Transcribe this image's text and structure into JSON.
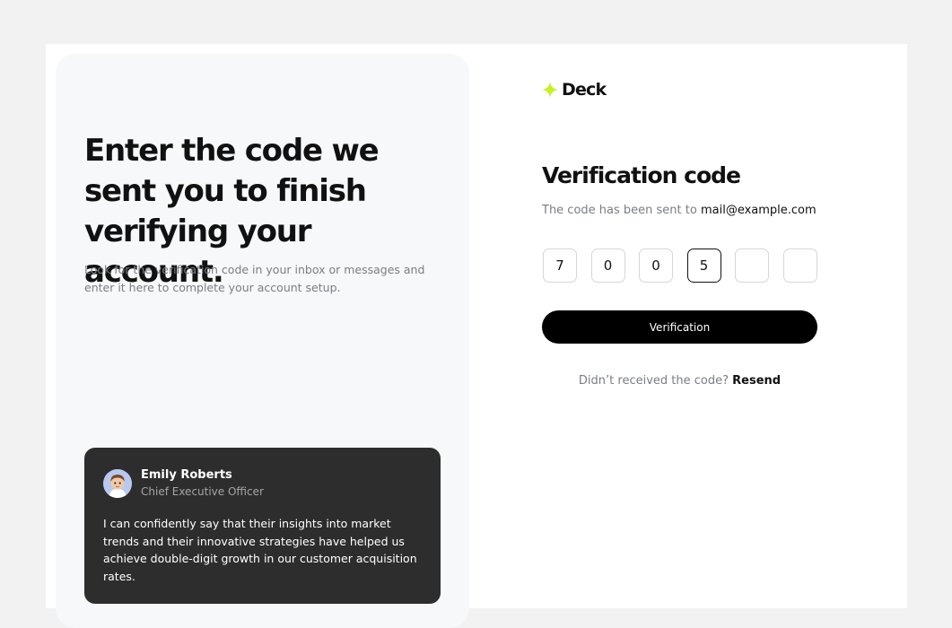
{
  "colors": {
    "accent": "#c6f221",
    "dark_card": "#2d2d2d",
    "button": "#000000"
  },
  "hero": {
    "headline": "Enter the code we sent you to finish verifying your account.",
    "subtext": "Look for the verification code in your inbox or messages and enter it here to complete your account setup."
  },
  "testimonial": {
    "name": "Emily Roberts",
    "role": "Chief Executive Officer",
    "quote": "I can confidently say that their insights into market trends and their innovative strategies have helped us achieve double-digit growth in our customer acquisition rates."
  },
  "brand": {
    "name": "Deck",
    "icon": "sparkle-icon"
  },
  "form": {
    "title": "Verification code",
    "sent_prefix": "The code has been sent to",
    "email": "mail@example.com",
    "otp": [
      "7",
      "0",
      "0",
      "5",
      "",
      ""
    ],
    "submit_label": "Verification",
    "resend_prompt": "Didn’t received the code?",
    "resend_label": "Resend"
  }
}
